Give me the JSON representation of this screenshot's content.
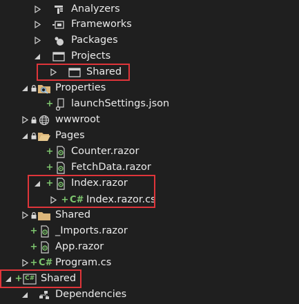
{
  "tree": {
    "nodes": {
      "analyzers": "Analyzers",
      "frameworks": "Frameworks",
      "packages": "Packages",
      "projects": "Projects",
      "shared_ref": "Shared",
      "properties": "Properties",
      "launch_settings": "launchSettings.json",
      "wwwroot": "wwwroot",
      "pages": "Pages",
      "counter": "Counter.razor",
      "fetchdata": "FetchData.razor",
      "index_razor": "Index.razor",
      "index_razor_cs": "Index.razor.cs",
      "shared_folder": "Shared",
      "imports": "_Imports.razor",
      "app": "App.razor",
      "program": "Program.cs",
      "shared_project": "Shared",
      "dependencies": "Dependencies"
    },
    "badges": {
      "added": "+"
    },
    "icons": {
      "csharp": "C#"
    }
  },
  "colors": {
    "background": "#1f1f1f",
    "text": "#ebebeb",
    "highlight_border": "#e0353a",
    "added_badge": "#7ec76f",
    "folder": "#dcb67a",
    "globe": "#9cc4e4"
  }
}
